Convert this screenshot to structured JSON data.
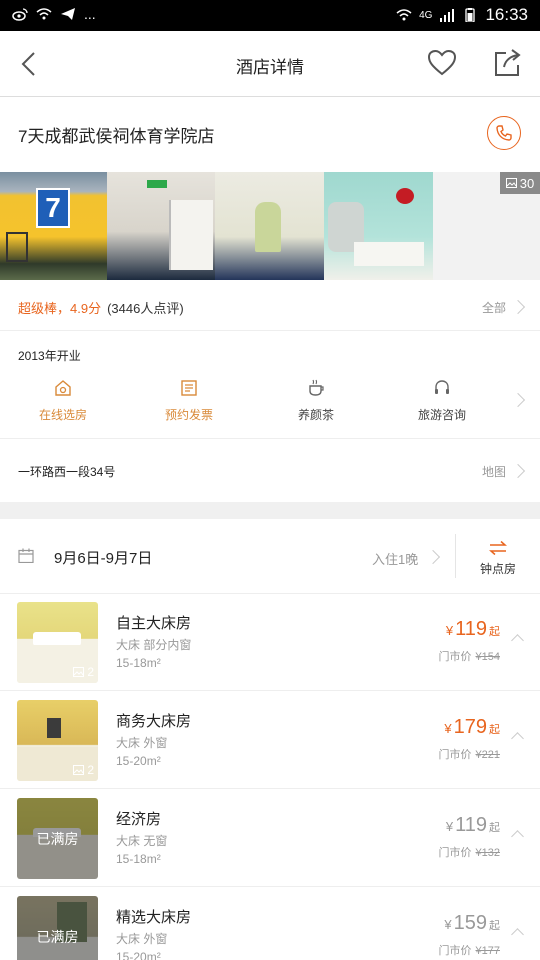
{
  "status_bar": {
    "network": "4G",
    "time": "16:33",
    "dots": "..."
  },
  "header": {
    "title": "酒店详情"
  },
  "hotel": {
    "name": "7天成都武侯祠体育学院店"
  },
  "gallery": {
    "photo_count": "30",
    "sign_text": "7"
  },
  "rating": {
    "score": "超级棒，4.9分",
    "reviews": "(3446人点评)",
    "all_label": "全部"
  },
  "opened": "2013年开业",
  "facilities": [
    {
      "label": "在线选房",
      "icon": "house-icon",
      "color": "#d98a3a"
    },
    {
      "label": "预约发票",
      "icon": "invoice-icon",
      "color": "#d98a3a"
    },
    {
      "label": "养颜茶",
      "icon": "tea-cup-icon",
      "color": "#444444"
    },
    {
      "label": "旅游咨询",
      "icon": "headset-icon",
      "color": "#444444"
    }
  ],
  "address": {
    "text": "一环路西一段34号",
    "map_label": "地图"
  },
  "booking": {
    "dates": "9月6日-9月7日",
    "nights": "入住1晚",
    "hourly_label": "钟点房"
  },
  "rooms": [
    {
      "name": "自主大床房",
      "desc": "大床   部分内窗",
      "size": "15-18m²",
      "price": "119",
      "currency": "¥",
      "qi": "起",
      "orig_label": "门市价",
      "orig_price": "¥154",
      "img_count": "2",
      "full": "",
      "available": true
    },
    {
      "name": "商务大床房",
      "desc": "大床   外窗",
      "size": "15-20m²",
      "price": "179",
      "currency": "¥",
      "qi": "起",
      "orig_label": "门市价",
      "orig_price": "¥221",
      "img_count": "2",
      "full": "",
      "available": true
    },
    {
      "name": "经济房",
      "desc": "大床   无窗",
      "size": "15-18m²",
      "price": "119",
      "currency": "¥",
      "qi": "起",
      "orig_label": "门市价",
      "orig_price": "¥132",
      "img_count": "",
      "full": "已满房",
      "available": false
    },
    {
      "name": "精选大床房",
      "desc": "大床   外窗",
      "size": "15-20m²",
      "price": "159",
      "currency": "¥",
      "qi": "起",
      "orig_label": "门市价",
      "orig_price": "¥177",
      "img_count": "",
      "full": "已满房",
      "available": false
    }
  ],
  "colors": {
    "accent": "#e8651f",
    "facility_orange": "#d98a3a",
    "muted": "#999999"
  }
}
